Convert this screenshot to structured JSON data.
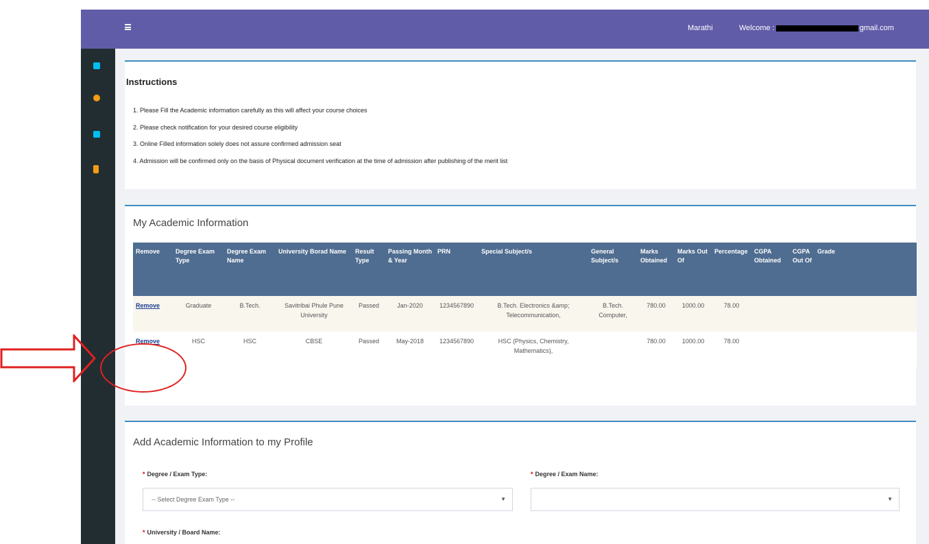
{
  "topbar": {
    "language": "Marathi",
    "welcome_label": "Welcome :",
    "email_tail": "gmail.com"
  },
  "sidebar": {
    "icons": [
      "home-icon",
      "user-icon",
      "edit-icon",
      "document-icon"
    ],
    "colors": [
      "#00c0ef",
      "#f39c12",
      "#00c0ef",
      "#f39c12"
    ]
  },
  "instructions": {
    "title": "Instructions",
    "items": [
      "1. Please Fill the Academic information carefully as this will affect your course choices",
      "2. Please check notification for your desired course eligibility",
      "3. Online Filled information solely does not assure confirmed admission seat",
      "4. Admission will be confirmed only on the basis of Physical document verification at the time of admission after publishing of the merit list"
    ]
  },
  "academic": {
    "title": "My Academic Information",
    "headers": [
      "Remove",
      "Degree Exam Type",
      "Degree Exam Name",
      "University Borad Name",
      "Result Type",
      "Passing Month & Year",
      "PRN",
      "Special Subject/s",
      "General Subject/s",
      "Marks Obtained",
      "Marks Out Of",
      "Percentage",
      "CGPA Obtained",
      "CGPA Out Of",
      "Grade"
    ],
    "rows": [
      [
        "Remove",
        "Graduate",
        "B.Tech.",
        "Savitribai Phule Pune University",
        "Passed",
        "Jan-2020",
        "1234567890",
        "B.Tech. Electronics &amp; Telecommunication,",
        "B.Tech. Computer,",
        "780.00",
        "1000.00",
        "78.00",
        "",
        "",
        ""
      ],
      [
        "Remove",
        "HSC",
        "HSC",
        "CBSE",
        "Passed",
        "May-2018",
        "1234567890",
        "HSC (Physics, Chemistry, Mathematics),",
        "",
        "780.00",
        "1000.00",
        "78.00",
        "",
        "",
        ""
      ]
    ]
  },
  "add_form": {
    "title": "Add Academic Information to my Profile",
    "degree_type_label": "Degree / Exam Type:",
    "degree_type_placeholder": "-- Select Degree Exam Type --",
    "degree_name_label": "Degree / Exam Name:",
    "degree_name_value": "",
    "university_label": "University / Board Name:"
  },
  "colors": {
    "topbar": "#605ca8",
    "sidebar": "#222d32",
    "table_header": "#4f6d90",
    "card_border": "#3c8dbc",
    "annotation": "#e02020"
  }
}
